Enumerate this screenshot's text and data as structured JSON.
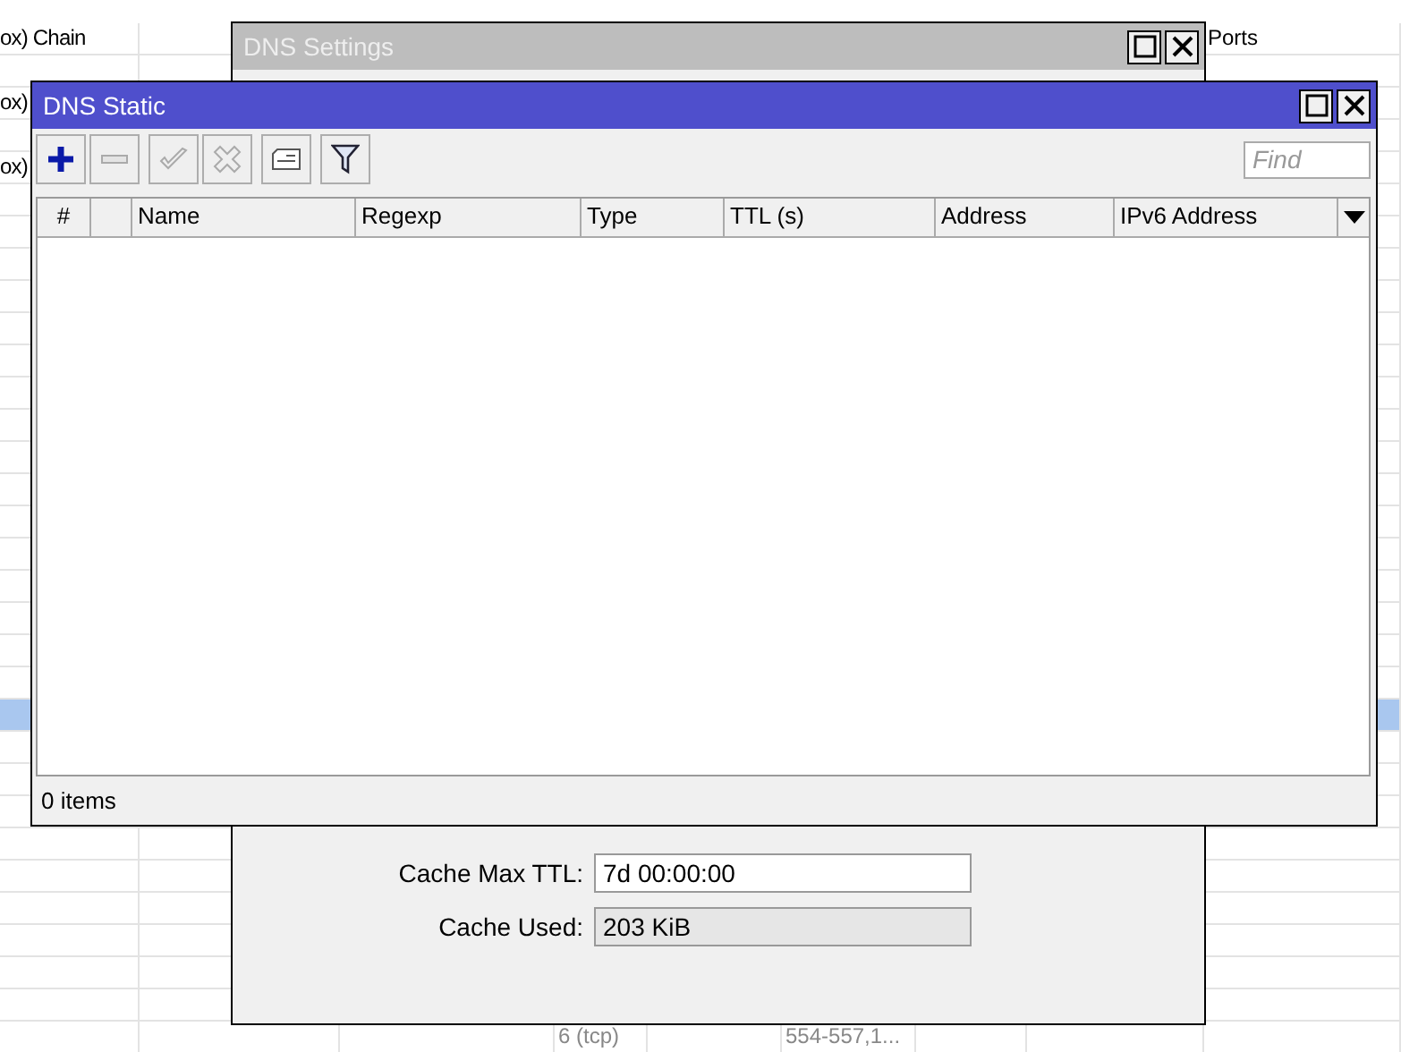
{
  "background_table": {
    "rows": [
      {
        "selected": false,
        "disabled": false,
        "cells": {
          "column_1": "ox) Chain",
          "column_9": "Ports"
        }
      },
      {
        "selected": false,
        "cells": {}
      },
      {
        "selected": false,
        "disabled": false,
        "cells": {
          "column_1": "ox)"
        }
      },
      {
        "selected": false,
        "cells": {}
      },
      {
        "selected": false,
        "disabled": false,
        "cells": {
          "column_1": "ox)"
        }
      },
      {
        "selected": false,
        "cells": {}
      },
      {
        "selected": false,
        "cells": {}
      },
      {
        "selected": false,
        "cells": {}
      },
      {
        "selected": false,
        "cells": {}
      },
      {
        "selected": false,
        "cells": {}
      },
      {
        "selected": false,
        "cells": {}
      },
      {
        "selected": false,
        "cells": {}
      },
      {
        "selected": false,
        "cells": {}
      },
      {
        "selected": false,
        "cells": {}
      },
      {
        "selected": false,
        "cells": {}
      },
      {
        "selected": false,
        "cells": {}
      },
      {
        "selected": false,
        "cells": {}
      },
      {
        "selected": false,
        "cells": {}
      },
      {
        "selected": false,
        "cells": {}
      },
      {
        "selected": false,
        "cells": {}
      },
      {
        "selected": false,
        "cells": {}
      },
      {
        "selected": true,
        "cells": {}
      },
      {
        "selected": false,
        "cells": {}
      },
      {
        "selected": false,
        "cells": {}
      },
      {
        "selected": false,
        "cells": {}
      },
      {
        "selected": false,
        "cells": {}
      },
      {
        "selected": false,
        "cells": {}
      },
      {
        "selected": false,
        "cells": {}
      },
      {
        "selected": false,
        "cells": {}
      },
      {
        "selected": false,
        "cells": {}
      },
      {
        "selected": false,
        "cells": {}
      },
      {
        "selected": false,
        "disabled": true,
        "cells": {
          "column_4": "6 (tcp)",
          "column_6": "554-557,1..."
        }
      }
    ]
  },
  "dns_settings": {
    "title": "DNS Settings",
    "fields": [
      {
        "label": "Cache Max TTL:",
        "value": "7d 00:00:00",
        "disabled": false
      },
      {
        "label": "Cache Used:",
        "value": "203 KiB",
        "disabled": true
      }
    ]
  },
  "dns_static": {
    "title": "DNS Static",
    "toolbar": [
      {
        "kind": "add",
        "disabled": false
      },
      {
        "kind": "remove",
        "disabled": true
      },
      {
        "kind": "enable",
        "disabled": true
      },
      {
        "kind": "disable",
        "disabled": true
      },
      {
        "kind": "comment",
        "disabled": false
      },
      {
        "kind": "filter",
        "disabled": false
      }
    ],
    "search": {
      "placeholder": "Find"
    },
    "table": {
      "columns": [
        "#",
        "Name",
        "Regexp",
        "Type",
        "TTL (s)",
        "Address",
        "IPv6 Address"
      ]
    },
    "status_bar": "0 items"
  }
}
